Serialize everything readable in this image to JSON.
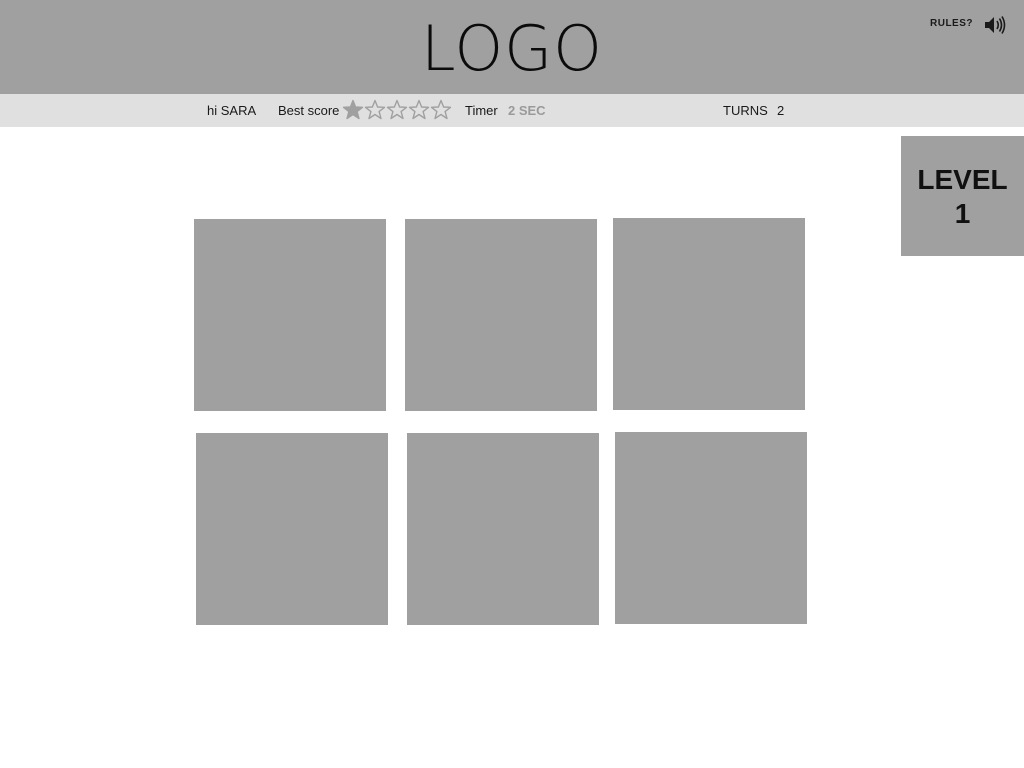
{
  "header": {
    "logo_text": "LOGO",
    "rules_label": "RULES?",
    "sound_icon": "speaker-volume-icon"
  },
  "status": {
    "greeting": "hi SARA",
    "best_score_label": "Best score",
    "best_score_stars": 1,
    "best_score_max": 5,
    "timer_label": "Timer",
    "timer_value": "2 SEC",
    "turns_label": "TURNS",
    "turns_value": "2"
  },
  "level": {
    "word": "LEVEL",
    "number": "1"
  },
  "board": {
    "card_count": 6
  },
  "colors": {
    "header_bg": "#a0a0a0",
    "status_bar_bg": "#e0e0e0",
    "card_bg": "#a0a0a0",
    "timer_value": "#9a9a9a"
  }
}
